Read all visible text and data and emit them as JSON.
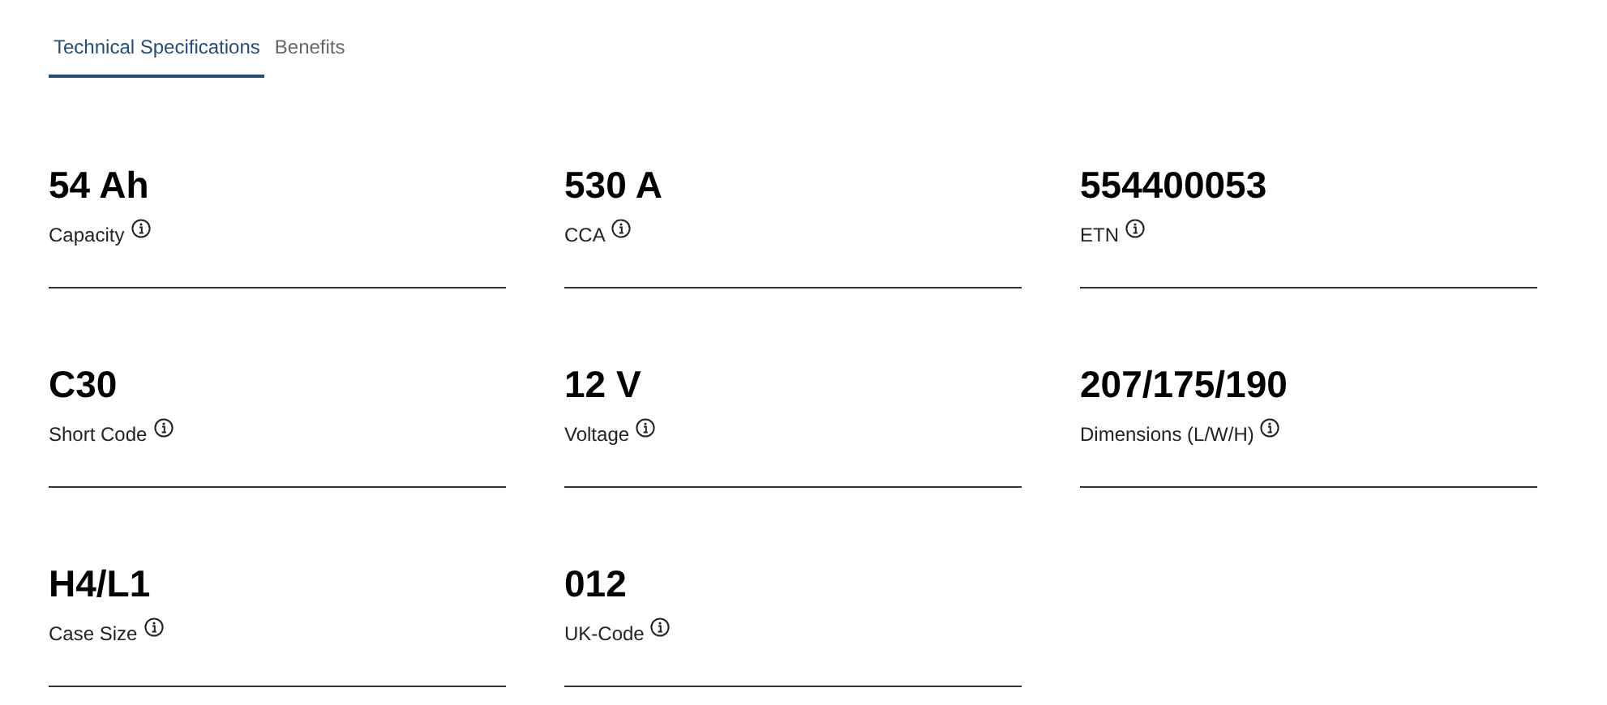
{
  "tabs": [
    {
      "label": "Technical Specifications",
      "selected": true
    },
    {
      "label": "Benefits",
      "selected": false
    }
  ],
  "specs": [
    {
      "value": "54 Ah",
      "label": "Capacity"
    },
    {
      "value": "530 A",
      "label": "CCA"
    },
    {
      "value": "554400053",
      "label": "ETN"
    },
    {
      "value": "C30",
      "label": "Short Code"
    },
    {
      "value": "12 V",
      "label": "Voltage"
    },
    {
      "value": "207/175/190",
      "label": "Dimensions (L/W/H)"
    },
    {
      "value": "H4/L1",
      "label": "Case Size"
    },
    {
      "value": "012",
      "label": "UK-Code"
    }
  ]
}
